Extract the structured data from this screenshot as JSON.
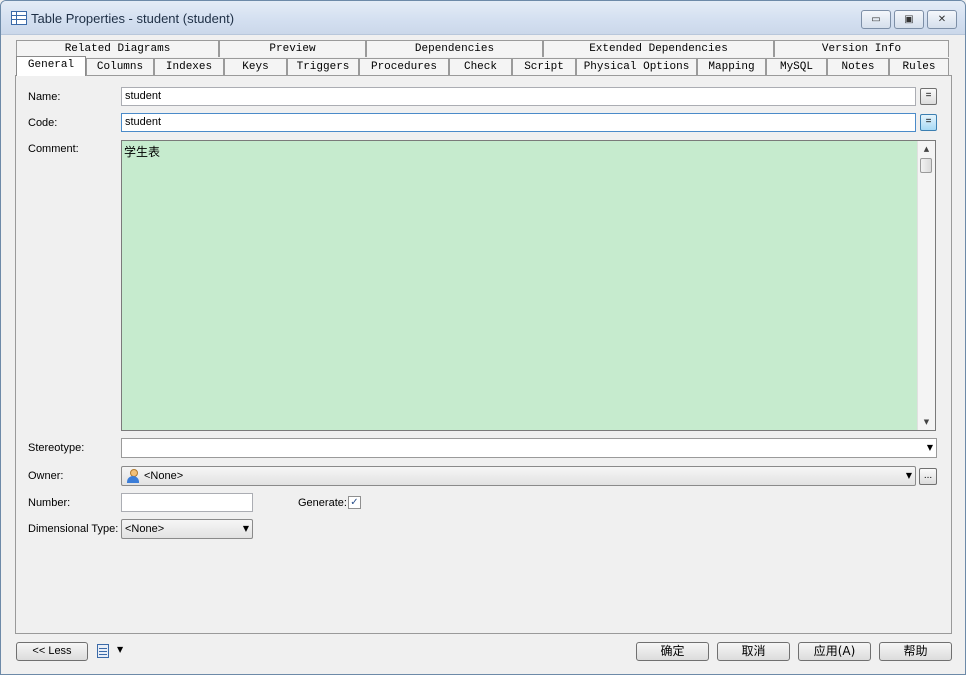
{
  "window": {
    "title": "Table Properties - student (student)",
    "minimize_glyph": "▭",
    "restore_glyph": "▣",
    "close_glyph": "✕"
  },
  "tabs_top": [
    "Related Diagrams",
    "Preview",
    "Dependencies",
    "Extended Dependencies",
    "Version Info"
  ],
  "tabs_bottom": [
    "General",
    "Columns",
    "Indexes",
    "Keys",
    "Triggers",
    "Procedures",
    "Check",
    "Script",
    "Physical Options",
    "Mapping",
    "MySQL",
    "Notes",
    "Rules"
  ],
  "active_tab": "General",
  "form": {
    "name_label": "Name:",
    "name_value": "student",
    "code_label": "Code:",
    "code_value": "student",
    "eq_glyph": "=",
    "comment_label": "Comment:",
    "comment_value": "学生表",
    "stereotype_label": "Stereotype:",
    "stereotype_value": "",
    "owner_label": "Owner:",
    "owner_value": "<None>",
    "owner_more": "...",
    "number_label": "Number:",
    "number_value": "",
    "generate_label": "Generate:",
    "generate_checked": true,
    "check_glyph": "✓",
    "dimensional_label": "Dimensional Type:",
    "dimensional_value": "<None>"
  },
  "icons": {
    "caret": "▼",
    "scroll_up": "▲",
    "scroll_down": "▼"
  },
  "footer": {
    "less_button": "<< Less",
    "ok_button": "确定",
    "cancel_button": "取消",
    "apply_button": "应用(A)",
    "help_button": "帮助"
  }
}
